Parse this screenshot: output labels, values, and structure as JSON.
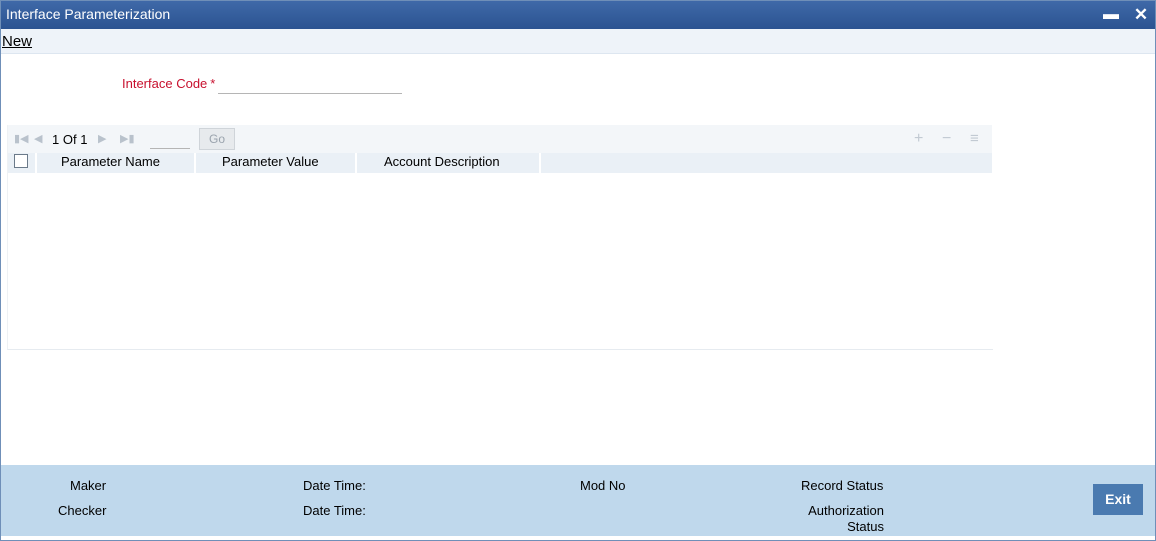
{
  "window": {
    "title": "Interface Parameterization",
    "minimize_glyph": "▬",
    "close_glyph": "✕"
  },
  "menu": {
    "new_label": "New"
  },
  "form": {
    "interface_code_label": "Interface Code",
    "required_mark": "*",
    "interface_code_value": ""
  },
  "grid": {
    "pagination": {
      "current": "1",
      "of_label": "Of",
      "total": "1",
      "go_label": "Go",
      "page_input_value": ""
    },
    "columns": [
      "Parameter Name",
      "Parameter Value",
      "Account Description"
    ],
    "rows": []
  },
  "footer": {
    "maker_label": "Maker",
    "checker_label": "Checker",
    "date_time_label": "Date Time:",
    "mod_no_label": "Mod No",
    "record_status_label": "Record Status",
    "authorization_status_label": "Authorization Status",
    "exit_label": "Exit"
  },
  "colors": {
    "titlebar": "#2b5391",
    "required_label": "#c8102e",
    "footer_bg": "#bfd8ec",
    "exit_button": "#4a7ab0"
  },
  "icons": {
    "first_page": "first-page-icon",
    "prev_page": "prev-page-icon",
    "next_page": "next-page-icon",
    "last_page": "last-page-icon",
    "add_row": "plus-icon",
    "delete_row": "minus-icon",
    "single_view": "list-icon"
  }
}
